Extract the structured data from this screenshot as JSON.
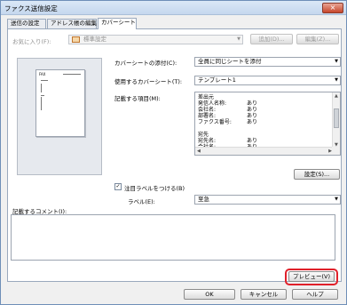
{
  "window": {
    "title": "ファクス送信設定",
    "close_label": "×"
  },
  "tabs": [
    {
      "label": "送信の設定"
    },
    {
      "label": "アドレス帳の編集"
    },
    {
      "label": "カバーシート"
    }
  ],
  "favorites": {
    "label": "お気に入り(F):",
    "value": "標準設定",
    "add_button": "追加(D)...",
    "edit_button": "編集(Z)..."
  },
  "preview": {
    "header_text": "FAX"
  },
  "coversheet": {
    "attach_label": "カバーシートの添付(C):",
    "attach_value": "全員に同じシートを添付",
    "use_label": "使用するカバーシート(T):",
    "use_value": "テンプレート1",
    "items_label": "記載する項目(M):",
    "items": [
      {
        "name": "差出元",
        "value": ""
      },
      {
        "name": "発信人名称:",
        "value": "あり"
      },
      {
        "name": "会社名:",
        "value": "あり"
      },
      {
        "name": "部署名:",
        "value": "あり"
      },
      {
        "name": "ファクス番号:",
        "value": "あり"
      },
      {
        "name": "",
        "value": ""
      },
      {
        "name": "宛先",
        "value": ""
      },
      {
        "name": "宛先名:",
        "value": "あり"
      },
      {
        "name": "会社名:",
        "value": "あり"
      }
    ],
    "settings_button": "設定(S)..."
  },
  "attention": {
    "checkbox_label": "注目ラベルをつける(B)",
    "checked": true,
    "check_mark": "✓",
    "label_label": "ラベル(E):",
    "label_value": "至急"
  },
  "comment": {
    "label": "記載するコメント(I):",
    "value": ""
  },
  "buttons": {
    "preview": "プレビュー(V)",
    "ok": "OK",
    "cancel": "キャンセル",
    "help": "ヘルプ"
  },
  "colors": {
    "highlight": "#e0202a"
  }
}
